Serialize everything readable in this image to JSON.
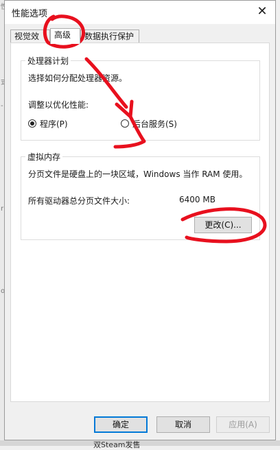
{
  "dialog": {
    "title": "性能选项",
    "close_glyph": "✕"
  },
  "tabs": [
    {
      "label": "视觉效果"
    },
    {
      "label": "高级"
    },
    {
      "label": "数据执行保护"
    }
  ],
  "processor": {
    "group_title": "处理器计划",
    "description": "选择如何分配处理器资源。",
    "adjust_label": "调整以优化性能:",
    "options": [
      {
        "label": "程序(P)",
        "checked": true
      },
      {
        "label": "后台服务(S)",
        "checked": false
      }
    ]
  },
  "virtual_memory": {
    "group_title": "虚拟内存",
    "description": "分页文件是硬盘上的一块区域，Windows 当作 RAM 使用。",
    "total_label": "所有驱动器总分页文件大小:",
    "total_value": "6400 MB",
    "change_button": "更改(C)..."
  },
  "footer": {
    "ok": "确定",
    "cancel": "取消",
    "apply": "应用(A)"
  },
  "background": {
    "left_fragments": [
      "性",
      "式",
      "-",
      "ri",
      "o"
    ],
    "bottom_text": "双Steam发售"
  },
  "colors": {
    "annotation_red": "#e8101e",
    "accent_blue": "#0078d7"
  }
}
